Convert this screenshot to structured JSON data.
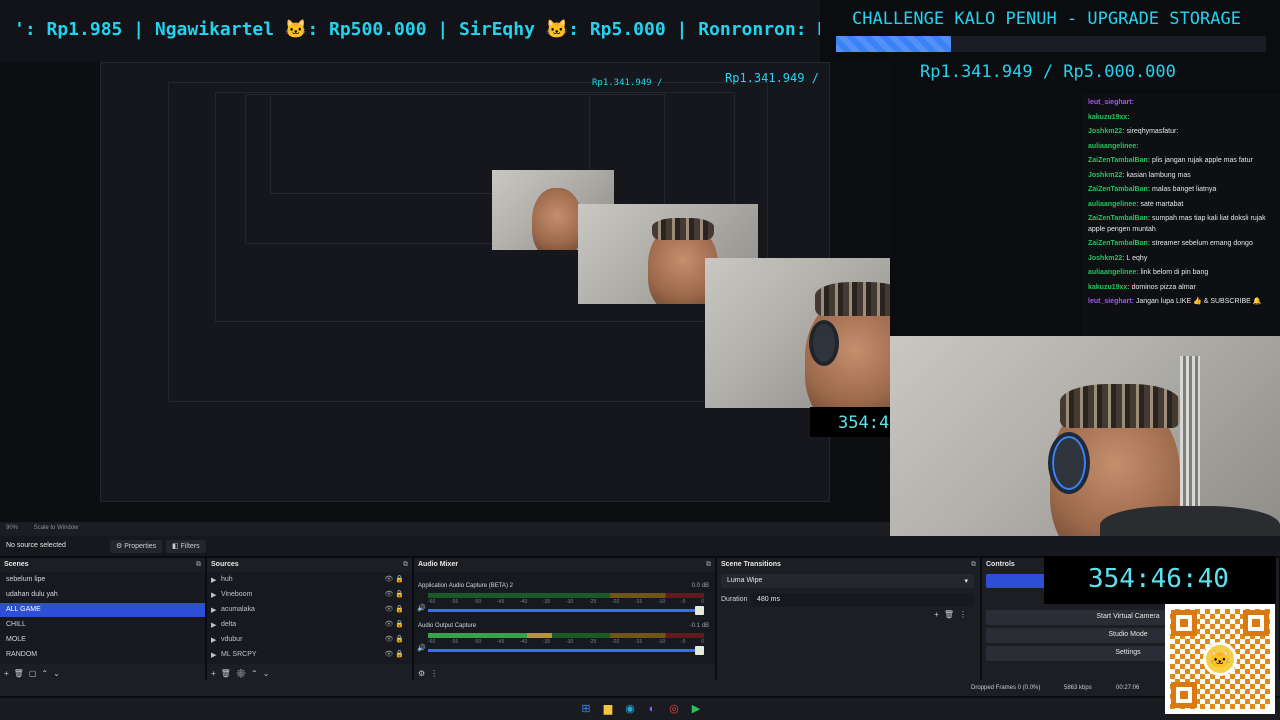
{
  "ticker": {
    "text": "': Rp1.985 | Ngawikartel 🐱: Rp500.000 | SirEqhy 🐱: Rp5.000 | Ronronron: Rp"
  },
  "challenge": {
    "title": "CHALLENGE KALO PENUH - UPGRADE STORAGE",
    "amount": "Rp1.341.949 / Rp5.000.000",
    "progress": 0.268,
    "accent": "#22d3ee"
  },
  "preview": {
    "mini_amount_1": "Rp1.341.949 /",
    "mini_amount_2": "Rp1.341.949 /",
    "mini_timer": "354:4"
  },
  "chat": [
    {
      "user": "leut_sieghart:",
      "msg": "",
      "purple": true
    },
    {
      "user": "kakuzu19xx:",
      "msg": "",
      "purple": false
    },
    {
      "user": "Joshkm22:",
      "msg": "sireqhymasfatur:",
      "purple": false
    },
    {
      "user": "auliaangelinee:",
      "msg": "",
      "purple": false
    },
    {
      "user": "ZaiZenTambalBan:",
      "msg": "plis jangan rujak apple mas fatur",
      "purple": false
    },
    {
      "user": "Joshkm22:",
      "msg": "kasian lambung mas",
      "purple": false
    },
    {
      "user": "ZaiZenTambalBan:",
      "msg": "malas banget liatnya",
      "purple": false
    },
    {
      "user": "auliaangelinee:",
      "msg": "sate martabat",
      "purple": false
    },
    {
      "user": "ZaiZenTambalBan:",
      "msg": "sumpah mas tiap kali liat doksli rujak apple pengen muntah",
      "purple": false
    },
    {
      "user": "ZaiZenTambalBan:",
      "msg": "streamer sebelum emang dongo",
      "purple": false
    },
    {
      "user": "Joshkm22:",
      "msg": "L eqhy",
      "purple": false
    },
    {
      "user": "auliaangelinee:",
      "msg": "link belom di pin bang",
      "purple": false
    },
    {
      "user": "kakuzu19xx:",
      "msg": "dominos pizza almar",
      "purple": false
    },
    {
      "user": "leut_sieghart:",
      "msg": "Jangan lupa LIKE 👍 & SUBSCRIBE 🔔",
      "purple": true
    }
  ],
  "obs": {
    "zoom": "90%",
    "scale": "Scale to Window",
    "no_source": "No source selected",
    "properties": "Properties",
    "filters": "Filters",
    "scenes_title": "Scenes",
    "scenes": [
      "sebelum lipe",
      "udahan dulu yah",
      "ALL GAME",
      "CHILL",
      "MOLE",
      "RANDOM"
    ],
    "selected_scene_index": 2,
    "sources_title": "Sources",
    "sources": [
      "huh",
      "Vineboom",
      "acumalaka",
      "delta",
      "vdubur",
      "ML SRCPY"
    ],
    "mixer_title": "Audio Mixer",
    "mixer": [
      {
        "name": "Application Audio Capture (BETA) 2",
        "db": "0.0 dB",
        "level": 0.0
      },
      {
        "name": "Audio Output Capture",
        "db": "-0.1 dB",
        "level": 0.45
      }
    ],
    "scale_ticks": [
      "-60",
      "-55",
      "-50",
      "-45",
      "-40",
      "-35",
      "-30",
      "-25",
      "-20",
      "-15",
      "-10",
      "-5",
      "0"
    ],
    "transitions_title": "Scene Transitions",
    "transition": "Luma Wipe",
    "duration_label": "Duration",
    "duration": "480 ms",
    "controls_title": "Controls",
    "controls": [
      "Start Virtual Camera",
      "Studio Mode",
      "Settings"
    ],
    "dropped": "Dropped Frames 0 (0.0%)",
    "kbps": "5863 kbps",
    "time": "00:27:06"
  },
  "timer": "354:46:40",
  "taskbar": {
    "icons": [
      {
        "name": "windows-icon",
        "glyph": "⊞",
        "color": "#3b82f6"
      },
      {
        "name": "folder-icon",
        "glyph": "▆",
        "color": "#f5c542"
      },
      {
        "name": "edge-icon",
        "glyph": "◉",
        "color": "#22a7d6"
      },
      {
        "name": "discord-icon",
        "glyph": "◐",
        "color": "#8b5cf6"
      },
      {
        "name": "chrome-icon",
        "glyph": "◎",
        "color": "#ef4444"
      },
      {
        "name": "play-icon",
        "glyph": "▶",
        "color": "#22c55e"
      }
    ]
  }
}
